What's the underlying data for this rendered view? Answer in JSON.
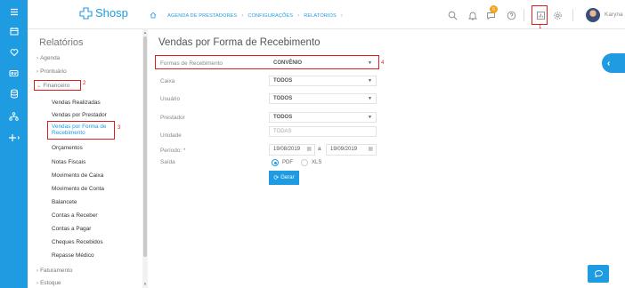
{
  "colors": {
    "brand": "#1f9be2",
    "annotation": "#e11d1d",
    "badge": "#f1a51c"
  },
  "app": {
    "logo_text": "Shosp"
  },
  "breadcrumb": [
    "Agenda de Prestadores",
    "Configurações",
    "Relatórios"
  ],
  "header": {
    "notification_count": "6",
    "username": "Karyna",
    "marker_1": "1"
  },
  "rail_icons": [
    "hamburger-icon",
    "calendar-icon",
    "heart-icon",
    "id-card-icon",
    "database-icon",
    "hierarchy-icon",
    "plus-icon"
  ],
  "sidebar": {
    "title": "Relatórios",
    "items": [
      {
        "label": "Agenda",
        "expanded": false
      },
      {
        "label": "Prontuário",
        "expanded": false
      },
      {
        "label": "Financeiro",
        "expanded": true,
        "marker": "2"
      }
    ],
    "financeiro_items": [
      "Vendas Realizadas",
      "Vendas por Prestador",
      "Vendas por Forma de Recebimento",
      "Orçamentos",
      "Notas Fiscais",
      "Movimento de Caixa",
      "Movimento de Conta",
      "Balancete",
      "Contas a Receber",
      "Contas a Pagar",
      "Cheques Recebidos",
      "Repasse Médico"
    ],
    "active_marker": "3",
    "bottom_items": [
      "Faturamento",
      "Estoque"
    ]
  },
  "form": {
    "title": "Vendas por Forma de Recebimento",
    "forma_label": "Formas de Recebimento",
    "forma_value": "CONVÊNIO",
    "forma_marker": "4",
    "caixa_label": "Caixa",
    "caixa_value": "TODOS",
    "usuario_label": "Usuário",
    "usuario_value": "TODOS",
    "prestador_label": "Prestador",
    "prestador_value": "TODOS",
    "unidade_label": "Unidade",
    "unidade_placeholder": "TODAS",
    "periodo_label": "Período: *",
    "periodo_start": "19/08/2019",
    "periodo_sep": "a",
    "periodo_end": "19/09/2019",
    "saida_label": "Saída",
    "saida_options": [
      "PDF",
      "XLS"
    ],
    "saida_selected": "PDF",
    "submit_label": "Gerar"
  }
}
